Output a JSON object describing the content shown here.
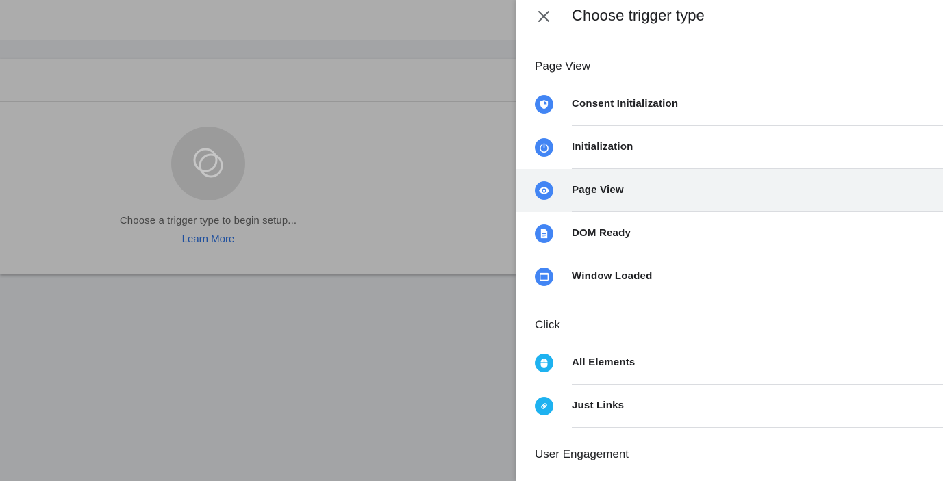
{
  "background": {
    "placeholder_text": "Choose a trigger type to begin setup...",
    "learn_more": "Learn More"
  },
  "panel": {
    "title": "Choose trigger type",
    "close_icon": "close-icon",
    "sections": [
      {
        "title": "Page View",
        "items": [
          {
            "label": "Consent Initialization",
            "icon": "shield-icon",
            "selected": false
          },
          {
            "label": "Initialization",
            "icon": "power-icon",
            "selected": false
          },
          {
            "label": "Page View",
            "icon": "eye-icon",
            "selected": true
          },
          {
            "label": "DOM Ready",
            "icon": "document-icon",
            "selected": false
          },
          {
            "label": "Window Loaded",
            "icon": "window-icon",
            "selected": false
          }
        ]
      },
      {
        "title": "Click",
        "items": [
          {
            "label": "All Elements",
            "icon": "mouse-icon",
            "selected": false
          },
          {
            "label": "Just Links",
            "icon": "link-icon",
            "selected": false
          }
        ]
      },
      {
        "title": "User Engagement",
        "items": []
      }
    ]
  },
  "colors": {
    "page_view_icon": "#4285f4",
    "click_icon": "#1eb2f0",
    "selected_row": "#f1f3f4",
    "link": "#1e4f9e"
  }
}
